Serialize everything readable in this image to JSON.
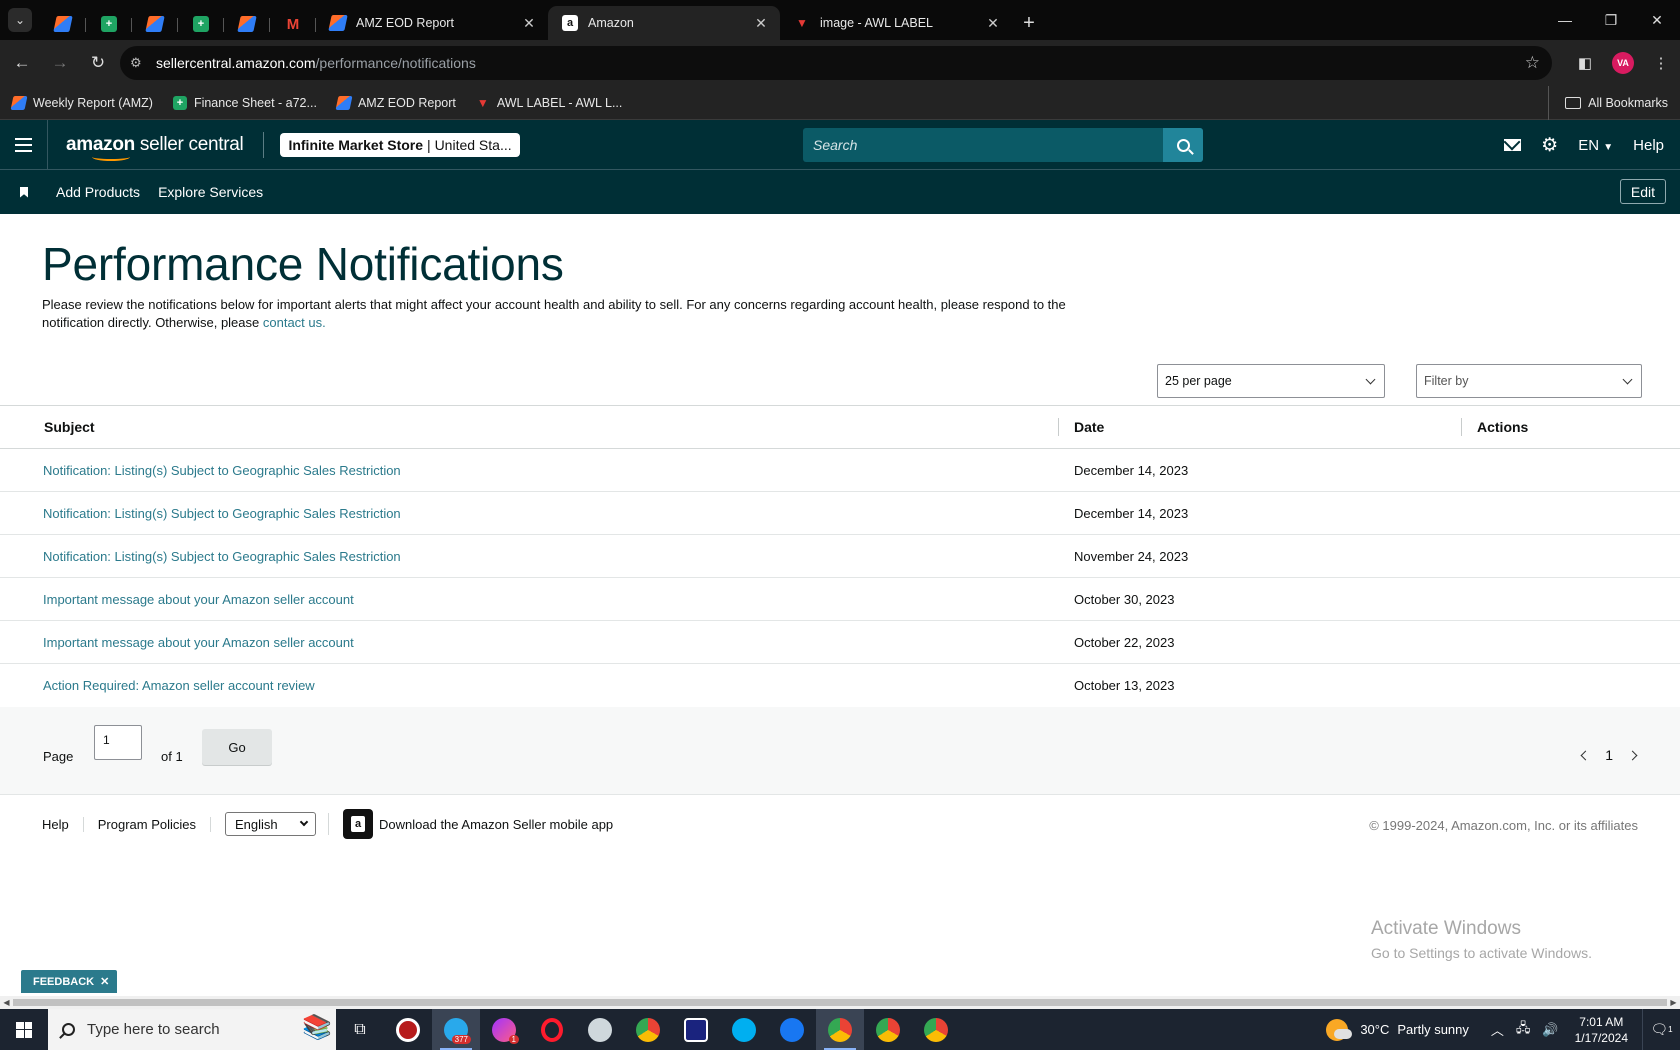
{
  "browser": {
    "tabs": [
      {
        "title": "AMZ EOD Report",
        "icon": "asana-icon"
      },
      {
        "title": "Amazon",
        "icon": "amazon-icon"
      },
      {
        "title": "image - AWL LABEL",
        "icon": "awl-icon"
      }
    ],
    "url_host": "sellercentral.amazon.com",
    "url_path": "/performance/notifications",
    "profile_initials": "VA",
    "bookmarks": [
      {
        "label": "Weekly Report (AMZ)",
        "icon": "asana-icon"
      },
      {
        "label": "Finance Sheet - a72...",
        "icon": "sheets-icon"
      },
      {
        "label": "AMZ EOD Report",
        "icon": "asana-icon"
      },
      {
        "label": "AWL LABEL - AWL L...",
        "icon": "awl-icon"
      }
    ],
    "all_bookmarks": "All Bookmarks"
  },
  "header": {
    "logo_bold": "amazon",
    "logo_rest": " seller central",
    "store_name": "Infinite Market Store",
    "store_region": "| United Sta...",
    "search_placeholder": "Search",
    "language": "EN",
    "help": "Help"
  },
  "subnav": {
    "items": [
      "Add Products",
      "Explore Services"
    ],
    "edit": "Edit"
  },
  "main": {
    "title": "Performance Notifications",
    "intro_text": "Please review the notifications below for important alerts that might affect your account health and ability to sell. For any concerns regarding account health, please respond to the notification directly. Otherwise, please ",
    "intro_link": "contact us.",
    "per_page": "25 per page",
    "filter_placeholder": "Filter by",
    "columns": {
      "subject": "Subject",
      "date": "Date",
      "actions": "Actions"
    },
    "rows": [
      {
        "subject": "Notification: Listing(s) Subject to Geographic Sales Restriction",
        "date": "December 14, 2023"
      },
      {
        "subject": "Notification: Listing(s) Subject to Geographic Sales Restriction",
        "date": "December 14, 2023"
      },
      {
        "subject": "Notification: Listing(s) Subject to Geographic Sales Restriction",
        "date": "November 24, 2023"
      },
      {
        "subject": "Important message about your Amazon seller account",
        "date": "October 30, 2023"
      },
      {
        "subject": "Important message about your Amazon seller account",
        "date": "October 22, 2023"
      },
      {
        "subject": "Action Required: Amazon seller account review",
        "date": "October 13, 2023"
      }
    ],
    "pager": {
      "page_label": "Page",
      "page_value": "1",
      "of_label": "of 1",
      "go": "Go",
      "current": "1"
    }
  },
  "footer": {
    "help": "Help",
    "policies": "Program Policies",
    "language": "English",
    "app_text": "Download the Amazon Seller mobile app",
    "copyright": "© 1999-2024, Amazon.com, Inc. or its affiliates"
  },
  "watermark": {
    "line1": "Activate Windows",
    "line2": "Go to Settings to activate Windows."
  },
  "feedback": "FEEDBACK",
  "taskbar": {
    "search_placeholder": "Type here to search",
    "telegram_badge": "377",
    "messenger_badge": "1",
    "temperature": "30°C",
    "weather": "Partly sunny",
    "time": "7:01 AM",
    "date": "1/17/2024",
    "notification_count": "1"
  },
  "colors": {
    "header_bg": "#002f36",
    "link": "#2b7a8c",
    "search_btn": "#21859a"
  }
}
